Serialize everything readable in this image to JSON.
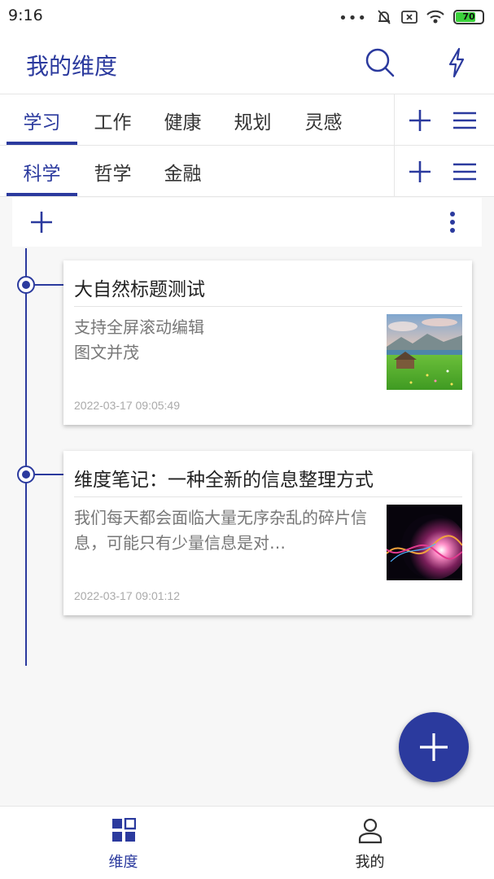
{
  "status_bar": {
    "time": "9:16",
    "battery_level": "70"
  },
  "app_bar": {
    "title": "我的维度",
    "search_icon": "search-icon",
    "flash_icon": "lightning-icon"
  },
  "primary_tabs": {
    "items": [
      {
        "label": "学习",
        "active": true
      },
      {
        "label": "工作",
        "active": false
      },
      {
        "label": "健康",
        "active": false
      },
      {
        "label": "规划",
        "active": false
      },
      {
        "label": "灵感",
        "active": false
      }
    ]
  },
  "secondary_tabs": {
    "items": [
      {
        "label": "科学",
        "active": true
      },
      {
        "label": "哲学",
        "active": false
      },
      {
        "label": "金融",
        "active": false
      }
    ]
  },
  "notes": [
    {
      "title": "大自然标题测试",
      "summary": "支持全屏滚动编辑\n图文并茂",
      "date": "2022-03-17 09:05:49",
      "thumbnail": "landscape-image"
    },
    {
      "title": "维度笔记：一种全新的信息整理方式",
      "summary": "我们每天都会面临大量无序杂乱的碎片信息，可能只有少量信息是对…",
      "date": "2022-03-17 09:01:12",
      "thumbnail": "abstract-light-image"
    }
  ],
  "bottom_nav": {
    "items": [
      {
        "label": "维度",
        "icon": "grid-icon",
        "active": true
      },
      {
        "label": "我的",
        "icon": "person-icon",
        "active": false
      }
    ]
  },
  "colors": {
    "accent": "#2b3a9e",
    "background": "#f7f7f7",
    "battery_green": "#3ad13a"
  }
}
